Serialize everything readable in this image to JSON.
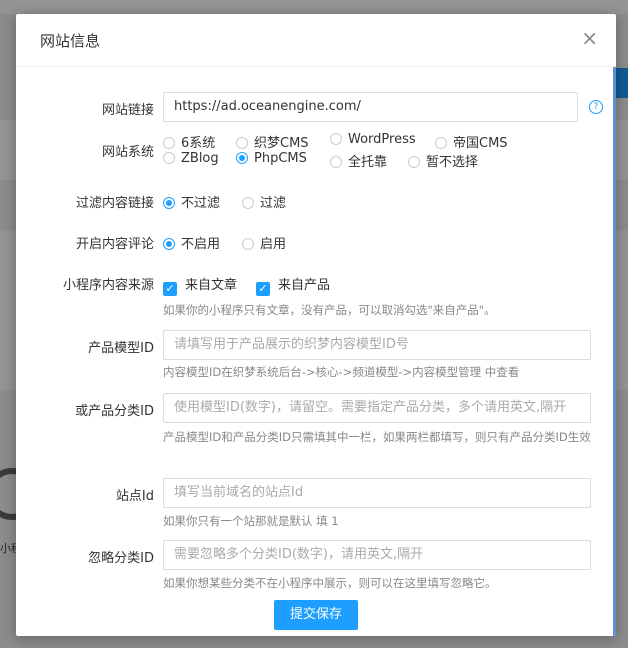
{
  "dialog": {
    "title": "网站信息",
    "close_glyph": "×",
    "submit_label": "提交保存"
  },
  "site_url": {
    "label": "网站链接",
    "value": "https://ad.oceanengine.com/",
    "help_icon": "question-circle-icon",
    "help_glyph": "?"
  },
  "site_system": {
    "label": "网站系统",
    "options": [
      "6系统",
      "织梦CMS",
      "WordPress",
      "帝国CMS",
      "ZBlog",
      "PhpCMS",
      "全托靠",
      "暂不选择"
    ],
    "selected": "PhpCMS"
  },
  "filter_links": {
    "label": "过滤内容链接",
    "options": [
      "不过滤",
      "过滤"
    ],
    "selected": "不过滤"
  },
  "comments": {
    "label": "开启内容评论",
    "options": [
      "不启用",
      "启用"
    ],
    "selected": "不启用"
  },
  "content_source": {
    "label": "小程序内容来源",
    "options": [
      "来自文章",
      "来自产品"
    ],
    "checked": [
      "来自文章",
      "来自产品"
    ],
    "check_glyph": "✓",
    "hint": "如果你的小程序只有文章，没有产品，可以取消勾选\"来自产品\"。"
  },
  "product_model_id": {
    "label": "产品模型ID",
    "placeholder": "请填写用于产品展示的织梦内容模型ID号",
    "hint": "内容模型ID在织梦系统后台->核心->频道模型->内容模型管理 中查看"
  },
  "product_category_id": {
    "label": "或产品分类ID",
    "placeholder": "使用模型ID(数字)，请留空。需要指定产品分类，多个请用英文,隔开",
    "hint": "产品模型ID和产品分类ID只需填其中一栏，如果两栏都填写，则只有产品分类ID生效"
  },
  "site_id": {
    "label": "站点Id",
    "placeholder": "填写当前域名的站点Id",
    "hint": "如果你只有一个站那就是默认 填 1"
  },
  "ignore_category": {
    "label": "忽略分类ID",
    "placeholder": "需要忽略多个分类ID(数字)，请用英文,隔开",
    "hint": "如果你想某些分类不在小程序中展示，则可以在这里填写忽略它。"
  },
  "background": {
    "side_text": "小程"
  },
  "colors": {
    "accent": "#1e9fff"
  }
}
